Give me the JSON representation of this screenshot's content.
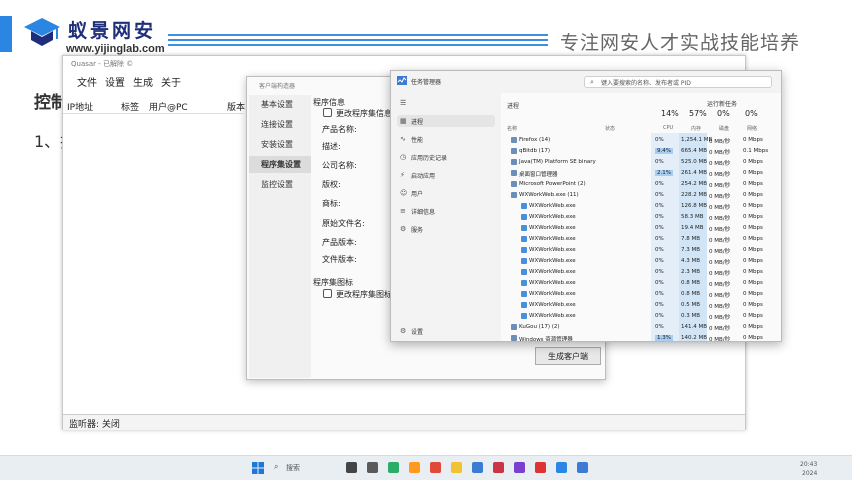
{
  "slide": {
    "brand_name": "蚁景网安",
    "brand_url": "www.yijinglab.com",
    "slogan": "专注网安人才实战技能培养",
    "title": "控制",
    "bullet": "1、找"
  },
  "main_window": {
    "title": "Quasar - 已解除 ©",
    "menu": [
      "文件",
      "设置",
      "生成",
      "关于"
    ],
    "columns": [
      "IP地址",
      "标签",
      "用户@PC",
      "版本"
    ],
    "status": "监听器: 关闭"
  },
  "builder_dialog": {
    "title": "客户端构造器",
    "nav": [
      "基本设置",
      "连接设置",
      "安装设置",
      "程序集设置",
      "监控设置"
    ],
    "active_nav": "程序集设置",
    "group_info": "程序信息",
    "change_info_label": "更改程序集信息",
    "fields": [
      "产品名称:",
      "描述:",
      "公司名称:",
      "版权:",
      "商标:",
      "原始文件名:",
      "产品版本:",
      "文件版本:"
    ],
    "group_icon": "程序集图标",
    "change_icon_label": "更改程序集图标",
    "build_button": "生成客户端"
  },
  "task_manager": {
    "title": "任务管理器",
    "search_placeholder": "键入要搜索的名称、发布者或 PID",
    "nav": [
      {
        "icon": "hamburger-icon",
        "label": ""
      },
      {
        "icon": "processes-icon",
        "label": "进程"
      },
      {
        "icon": "performance-icon",
        "label": "性能"
      },
      {
        "icon": "app-history-icon",
        "label": "应用历史记录"
      },
      {
        "icon": "startup-icon",
        "label": "启动应用"
      },
      {
        "icon": "users-icon",
        "label": "用户"
      },
      {
        "icon": "details-icon",
        "label": "详细信息"
      },
      {
        "icon": "services-icon",
        "label": "服务"
      }
    ],
    "settings_label": "设置",
    "section": "进程",
    "run_task": "运行新任务",
    "metrics": [
      {
        "value": "14%",
        "label": "CPU"
      },
      {
        "value": "57%",
        "label": "内存"
      },
      {
        "value": "0%",
        "label": "磁盘"
      },
      {
        "value": "0%",
        "label": "网络"
      }
    ],
    "col_name": "名称",
    "col_status": "状态",
    "processes": [
      {
        "name": "Firefox (14)",
        "cpu": "0%",
        "mem": "1,254.1 MB",
        "disk": "0 MB/秒",
        "net": "0 Mbps",
        "hi": false
      },
      {
        "name": "qBitdb (17)",
        "cpu": "9.4%",
        "mem": "665.4 MB",
        "disk": "0 MB/秒",
        "net": "0.1 Mbps",
        "hi": true
      },
      {
        "name": "Java(TM) Platform SE binary",
        "cpu": "0%",
        "mem": "525.0 MB",
        "disk": "0 MB/秒",
        "net": "0 Mbps",
        "hi": false
      },
      {
        "name": "桌面窗口管理器",
        "cpu": "2.1%",
        "mem": "261.4 MB",
        "disk": "0 MB/秒",
        "net": "0 Mbps",
        "hi": true
      },
      {
        "name": "Microsoft PowerPoint (2)",
        "cpu": "0%",
        "mem": "254.2 MB",
        "disk": "0 MB/秒",
        "net": "0 Mbps",
        "hi": false
      },
      {
        "name": "WXWorkWeb.exe (11)",
        "cpu": "0%",
        "mem": "228.2 MB",
        "disk": "0 MB/秒",
        "net": "0 Mbps",
        "hi": false
      },
      {
        "name": "WXWorkWeb.exe",
        "cpu": "0%",
        "mem": "126.8 MB",
        "disk": "0 MB/秒",
        "net": "0 Mbps",
        "hi": false
      },
      {
        "name": "WXWorkWeb.exe",
        "cpu": "0%",
        "mem": "58.3 MB",
        "disk": "0 MB/秒",
        "net": "0 Mbps",
        "hi": false
      },
      {
        "name": "WXWorkWeb.exe",
        "cpu": "0%",
        "mem": "19.4 MB",
        "disk": "0 MB/秒",
        "net": "0 Mbps",
        "hi": false
      },
      {
        "name": "WXWorkWeb.exe",
        "cpu": "0%",
        "mem": "7.8 MB",
        "disk": "0 MB/秒",
        "net": "0 Mbps",
        "hi": false
      },
      {
        "name": "WXWorkWeb.exe",
        "cpu": "0%",
        "mem": "7.3 MB",
        "disk": "0 MB/秒",
        "net": "0 Mbps",
        "hi": false
      },
      {
        "name": "WXWorkWeb.exe",
        "cpu": "0%",
        "mem": "4.3 MB",
        "disk": "0 MB/秒",
        "net": "0 Mbps",
        "hi": false
      },
      {
        "name": "WXWorkWeb.exe",
        "cpu": "0%",
        "mem": "2.3 MB",
        "disk": "0 MB/秒",
        "net": "0 Mbps",
        "hi": false
      },
      {
        "name": "WXWorkWeb.exe",
        "cpu": "0%",
        "mem": "0.8 MB",
        "disk": "0 MB/秒",
        "net": "0 Mbps",
        "hi": false
      },
      {
        "name": "WXWorkWeb.exe",
        "cpu": "0%",
        "mem": "0.8 MB",
        "disk": "0 MB/秒",
        "net": "0 Mbps",
        "hi": false
      },
      {
        "name": "WXWorkWeb.exe",
        "cpu": "0%",
        "mem": "0.5 MB",
        "disk": "0 MB/秒",
        "net": "0 Mbps",
        "hi": false
      },
      {
        "name": "WXWorkWeb.exe",
        "cpu": "0%",
        "mem": "0.3 MB",
        "disk": "0 MB/秒",
        "net": "0 Mbps",
        "hi": false
      },
      {
        "name": "KuGou (17) (2)",
        "cpu": "0%",
        "mem": "141.4 MB",
        "disk": "0 MB/秒",
        "net": "0 Mbps",
        "hi": false
      },
      {
        "name": "Windows 资源管理器",
        "cpu": "1.3%",
        "mem": "140.2 MB",
        "disk": "0 MB/秒",
        "net": "0 Mbps",
        "hi": true
      }
    ]
  },
  "taskbar": {
    "search_label": "搜索",
    "time": "20:43",
    "date": "2024"
  },
  "colors": {
    "accent": "#2a86e2",
    "brand": "#1f2e7a",
    "cpu_highlight": "#a9cdf0",
    "mem_column": "#c9e0f5"
  }
}
